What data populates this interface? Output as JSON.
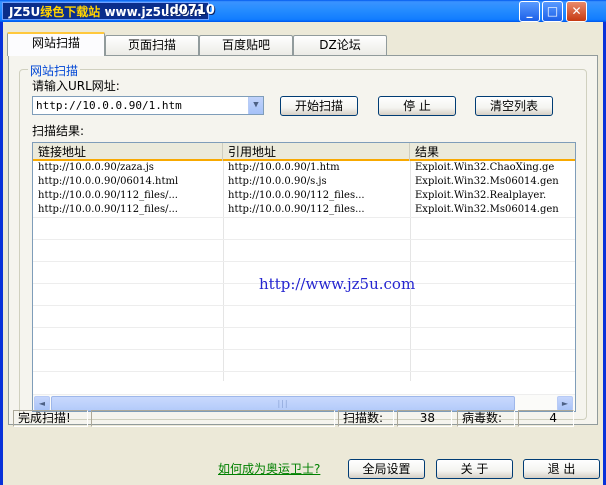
{
  "titlebar": {
    "watermark_left": "JZ5U",
    "watermark_green": "绿色下载站",
    "watermark_url": "www.jz5u.com",
    "title_text": "ld0710",
    "min": "_",
    "max": "□",
    "close": "✕"
  },
  "tabs": [
    {
      "label": "网站扫描",
      "active": true
    },
    {
      "label": "页面扫描",
      "active": false
    },
    {
      "label": "百度贴吧",
      "active": false
    },
    {
      "label": "DZ论坛",
      "active": false
    }
  ],
  "group": {
    "legend": "网站扫描",
    "url_label": "请输入URL网址:",
    "url_value": "http://10.0.0.90/1.htm",
    "results_label": "扫描结果:"
  },
  "buttons": {
    "start": "开始扫描",
    "stop": "停  止",
    "clear": "清空列表"
  },
  "list": {
    "columns": [
      "链接地址",
      "引用地址",
      "结果"
    ],
    "rows": [
      [
        "http://10.0.0.90/zaza.js",
        "http://10.0.0.90/1.htm",
        "Exploit.Win32.ChaoXing.ge"
      ],
      [
        "http://10.0.0.90/06014.html",
        "http://10.0.0.90/s.js",
        "Exploit.Win32.Ms06014.gen"
      ],
      [
        "http://10.0.0.90/112_files/...",
        "http://10.0.0.90/112_files...",
        "Exploit.Win32.Realplayer."
      ],
      [
        "http://10.0.0.90/112_files/...",
        "http://10.0.0.90/112_files...",
        "Exploit.Win32.Ms06014.gen"
      ]
    ],
    "watermark": "http://www.jz5u.com",
    "scroll_left": "◄",
    "scroll_right": "►",
    "scroll_grip": "|||"
  },
  "status": {
    "message": "完成扫描!",
    "scanned_label": "扫描数:",
    "scanned_value": "38",
    "virus_label": "病毒数:",
    "virus_value": "4"
  },
  "footer": {
    "link": "如何成为奥运卫士?",
    "settings": "全局设置",
    "about": "关  于",
    "exit": "退  出"
  }
}
